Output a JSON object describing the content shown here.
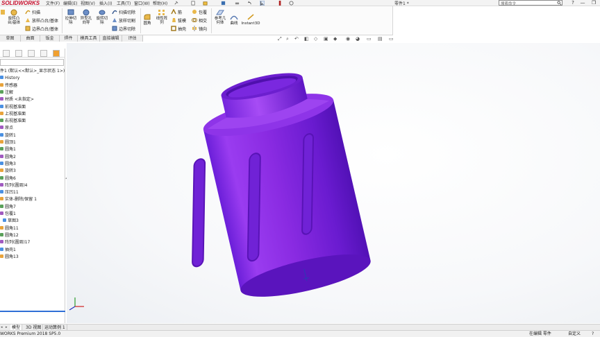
{
  "app": {
    "logo": "SOLIDWORKS",
    "menus": [
      "文件(F)",
      "编辑(E)",
      "视图(V)",
      "插入(I)",
      "工具(T)",
      "窗口(W)",
      "帮助(H)"
    ],
    "document_title": "零件1 *",
    "search_placeholder": "搜索命令",
    "window_controls": [
      "—",
      "❐",
      "✕"
    ]
  },
  "toolbar": {
    "revolve_boss": "旋转凸\n台/基体",
    "sweep": "扫描",
    "loft_boss": "放样凸台/基体",
    "boundary_boss": "边界凸台/基体",
    "extruded_cut": "拉伸切\n除",
    "hole_wizard": "异型孔\n向导",
    "revolved_cut": "旋转切\n除",
    "swept_cut": "扫描切除",
    "lofted_cut": "放样切割",
    "boundary_cut": "边界切除",
    "fillet": "圆角",
    "linear_pattern": "线性阵\n列",
    "rib": "筋",
    "draft": "拔模",
    "shell": "抽壳",
    "wrap": "包覆",
    "intersect": "相交",
    "mirror": "镜向",
    "ref_geometry": "参考几\n何体",
    "curves": "曲线",
    "instant3d": "Instant3D"
  },
  "tabs": [
    "草图",
    "曲面",
    "钣金",
    "焊件",
    "模具工具",
    "直接编辑",
    "评估"
  ],
  "feature_tree": {
    "root": "件1 (默认<<默认>_显示状态 1>)",
    "items": [
      "History",
      "传感器",
      "注解",
      "材质 <未指定>",
      "前视基准面",
      "上视基准面",
      "右视基准面",
      "原点",
      "旋转1",
      "圆顶1",
      "圆角1",
      "圆角2",
      "圆角3",
      "旋转3",
      "圆角6",
      "阵列(圆周)4",
      "压凹11",
      "实体-删除/保留 1",
      "圆角7",
      "包覆1",
      "草图3",
      "圆角11",
      "圆角12",
      "阵列(圆周)17",
      "抽壳1",
      "圆角13"
    ]
  },
  "bottom_tabs": [
    "模型",
    "3D 视图",
    "运动算例 1"
  ],
  "status": {
    "product": "WORKS Premium 2018 SP5.0",
    "mode": "在编辑 零件",
    "units": "自定义",
    "help": "?"
  },
  "colors": {
    "model": "#8a2be2",
    "accent": "#2f6fd6",
    "brand": "#c8102e"
  }
}
